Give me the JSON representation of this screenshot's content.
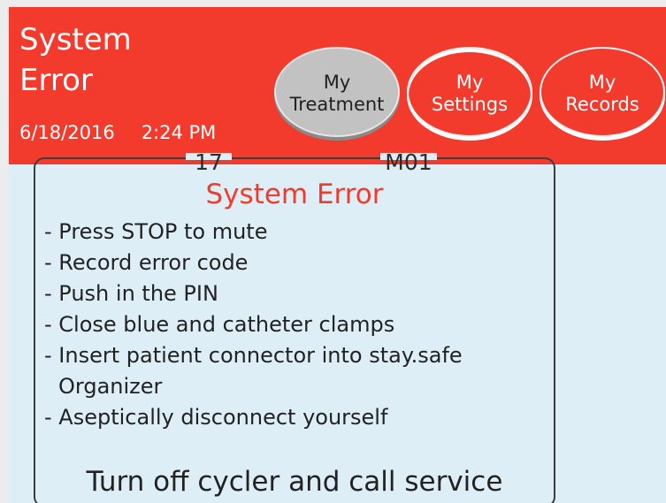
{
  "header": {
    "title_lines": [
      "System",
      "Error"
    ],
    "date": "6/18/2016",
    "time": "2:24 PM",
    "background_color": "#f23b2d"
  },
  "tabs": [
    {
      "lines": [
        "My",
        "Treatment"
      ],
      "selected": true
    },
    {
      "lines": [
        "My",
        "Settings"
      ],
      "selected": false
    },
    {
      "lines": [
        "My",
        "Records"
      ],
      "selected": false
    }
  ],
  "error": {
    "code_left": "17",
    "code_right": "M01",
    "title": "System Error",
    "instructions": [
      "- Press STOP to mute",
      "- Record error code",
      "- Push in the PIN",
      "- Close blue and catheter clamps",
      "- Insert patient connector into stay.safe",
      "  Organizer",
      "- Aseptically disconnect yourself"
    ],
    "final_instruction": "Turn off cycler and call service",
    "title_color": "#f23b2d"
  }
}
